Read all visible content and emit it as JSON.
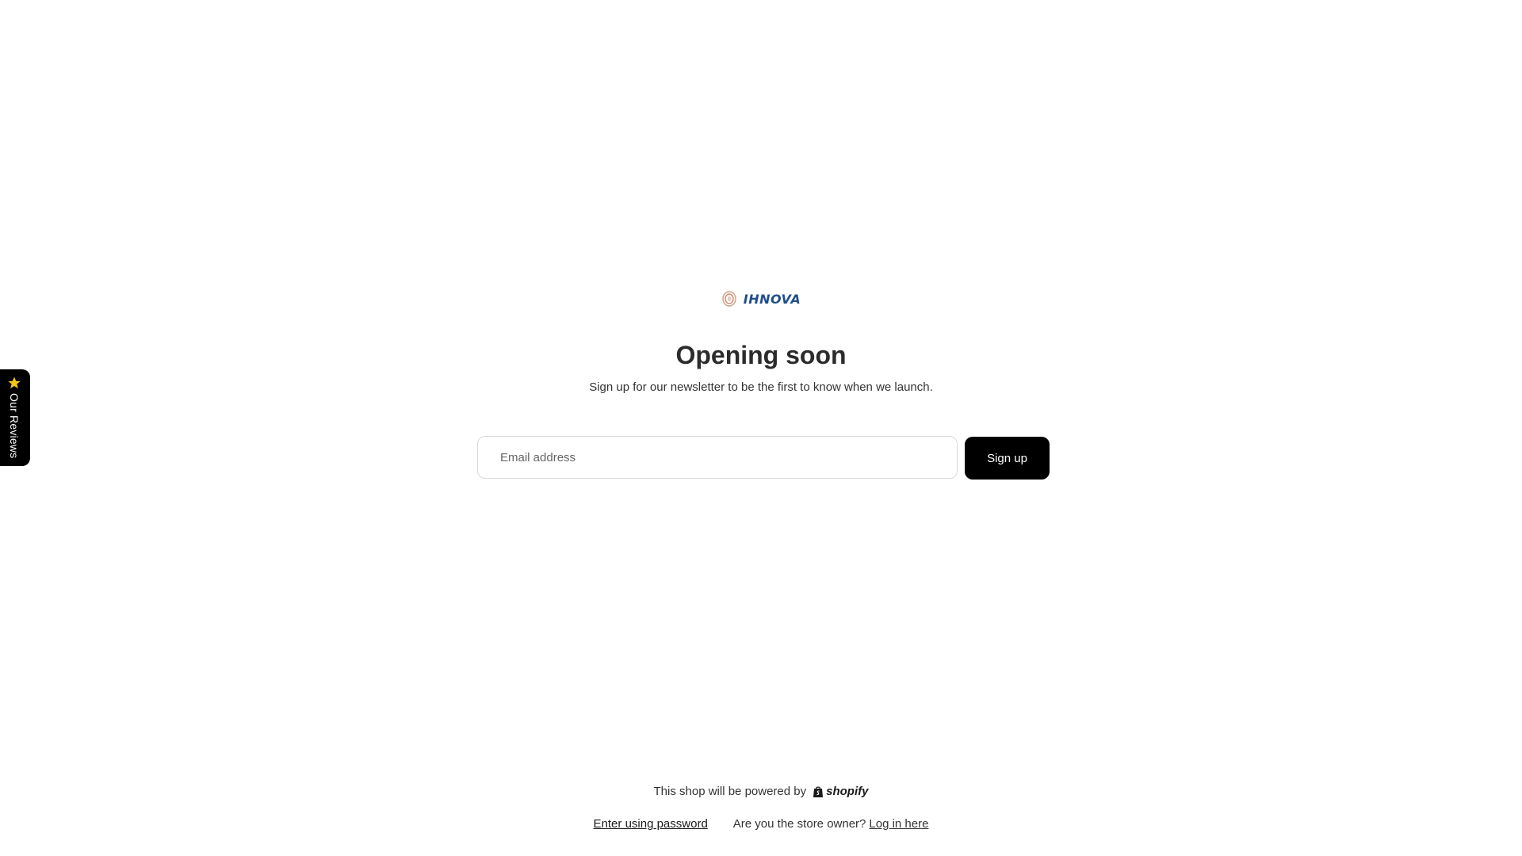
{
  "reviews_tab": {
    "label": "Our Reviews",
    "icon": "star-icon",
    "star_color": "#f5c518"
  },
  "brand": {
    "logo_text": "IHNOVA",
    "logo_color": "#1f4e8c"
  },
  "hero": {
    "title": "Opening soon",
    "subtitle": "Sign up for our newsletter to be the first to know when we launch."
  },
  "newsletter": {
    "email_placeholder": "Email address",
    "email_value": "",
    "submit_label": "Sign up"
  },
  "footer": {
    "powered_text": "This shop will be powered by",
    "shopify_label": "shopify",
    "enter_password_label": "Enter using password",
    "owner_question": "Are you the store owner?",
    "login_label": "Log in here"
  }
}
